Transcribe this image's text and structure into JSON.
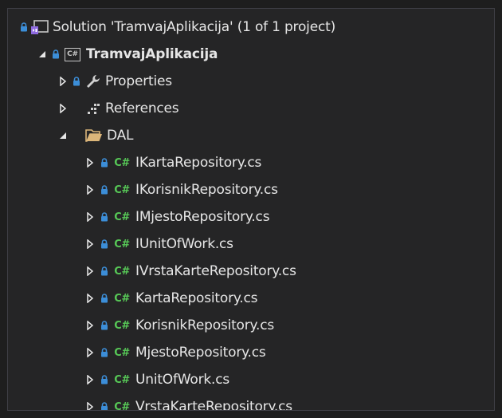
{
  "solution_explorer": {
    "solution": {
      "label": "Solution 'TramvajAplikacija' (1 of 1 project)",
      "icon": "visual-studio-solution-icon"
    },
    "project": {
      "label": "TramvajAplikacija",
      "icon": "csharp-project-icon",
      "project_icon_text": "C#"
    },
    "nodes": [
      {
        "label": "Properties",
        "icon": "wrench-icon"
      },
      {
        "label": "References",
        "icon": "references-icon"
      },
      {
        "label": "DAL",
        "icon": "folder-open-icon"
      }
    ],
    "cs_glyph": "C#",
    "dal_files": [
      {
        "label": "IKartaRepository.cs"
      },
      {
        "label": "IKorisnikRepository.cs"
      },
      {
        "label": "IMjestoRepository.cs"
      },
      {
        "label": "IUnitOfWork.cs"
      },
      {
        "label": "IVrstaKarteRepository.cs"
      },
      {
        "label": "KartaRepository.cs"
      },
      {
        "label": "KorisnikRepository.cs"
      },
      {
        "label": "MjestoRepository.cs"
      },
      {
        "label": "UnitOfWork.cs"
      },
      {
        "label": "VrstaKarteRepository.cs"
      }
    ],
    "colors": {
      "background": "#252526",
      "text": "#e6e6e6",
      "lock_blue": "#3c8ed8",
      "csharp_green": "#57c957",
      "folder_yellow": "#dcb67a",
      "solution_purple": "#8e6ae0"
    }
  }
}
